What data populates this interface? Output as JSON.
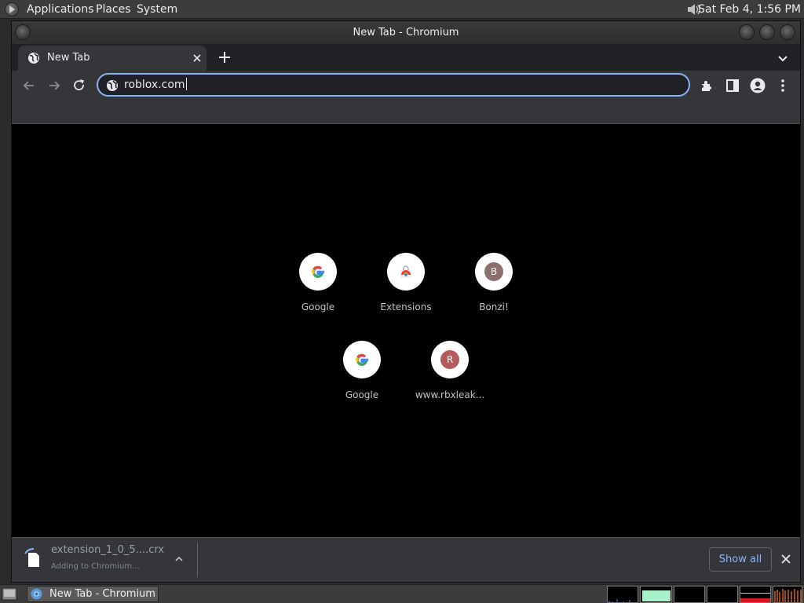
{
  "top_panel": {
    "menus": [
      "Applications",
      "Places",
      "System"
    ],
    "clock": "Sat Feb  4,  1:56 PM"
  },
  "window": {
    "title": "New Tab - Chromium"
  },
  "tab": {
    "title": "New Tab"
  },
  "omnibox": {
    "value": "roblox.com"
  },
  "shortcuts": [
    {
      "label": "Google",
      "icon": "google-icon"
    },
    {
      "label": "Extensions",
      "icon": "chrome-web-store-icon"
    },
    {
      "label": "Bonzi!",
      "letter": "B",
      "color": "#8d6e6e"
    },
    {
      "label": "Google",
      "icon": "google-icon"
    },
    {
      "label": "www.rbxleak...",
      "letter": "R",
      "color": "#b45c5c"
    }
  ],
  "download": {
    "filename": "extension_1_0_5....crx",
    "status": "Adding to Chromium..."
  },
  "shelf": {
    "show_all": "Show all"
  },
  "taskbar": {
    "window_label": "New Tab - Chromium"
  },
  "colors": {
    "accent": "#8ab4f8",
    "page_bg": "#000000",
    "toolbar_bg": "#35363a"
  }
}
